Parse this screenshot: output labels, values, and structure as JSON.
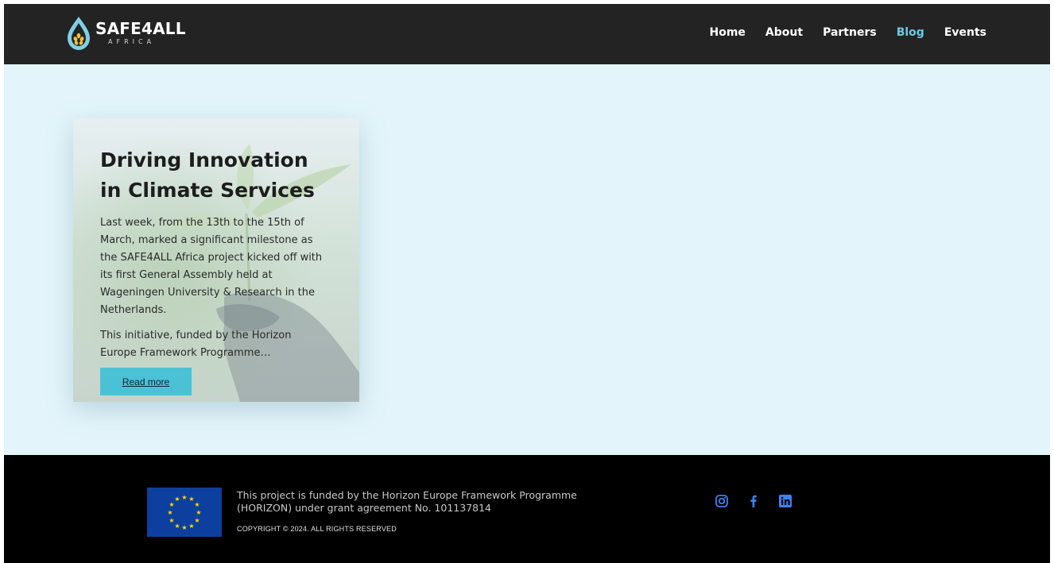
{
  "header": {
    "logo_title": "SAFE4ALL",
    "logo_subtitle": "AFRICA",
    "nav": [
      {
        "label": "Home",
        "active": false
      },
      {
        "label": "About",
        "active": false
      },
      {
        "label": "Partners",
        "active": false
      },
      {
        "label": "Blog",
        "active": true
      },
      {
        "label": "Events",
        "active": false
      }
    ]
  },
  "card": {
    "title": "Driving Innovation in Climate Services",
    "paragraph1": "Last week, from the 13th to the 15th of March, marked a significant milestone as the SAFE4ALL Africa project kicked off with its first General Assembly held at Wageningen University & Research in the Netherlands.",
    "paragraph2": "This initiative, funded by the Horizon Europe Framework Programme…",
    "button_label": "Read more"
  },
  "footer": {
    "funded_text": "This project is funded by the Horizon Europe Framework Programme (HORIZON) under grant agreement No. 101137814",
    "copyright": "COPYRIGHT © 2024. ALL RIGHTS RESERVED",
    "social": [
      "instagram-icon",
      "facebook-icon",
      "linkedin-icon"
    ]
  },
  "colors": {
    "header_bg": "#232323",
    "nav_active": "#6ec9e6",
    "main_bg": "#e3f5fa",
    "button_bg": "#4bc1d6",
    "footer_bg": "#000000",
    "social_icon": "#3b82f6",
    "eu_blue": "#0d3f9e",
    "eu_star": "#ffdd00"
  }
}
